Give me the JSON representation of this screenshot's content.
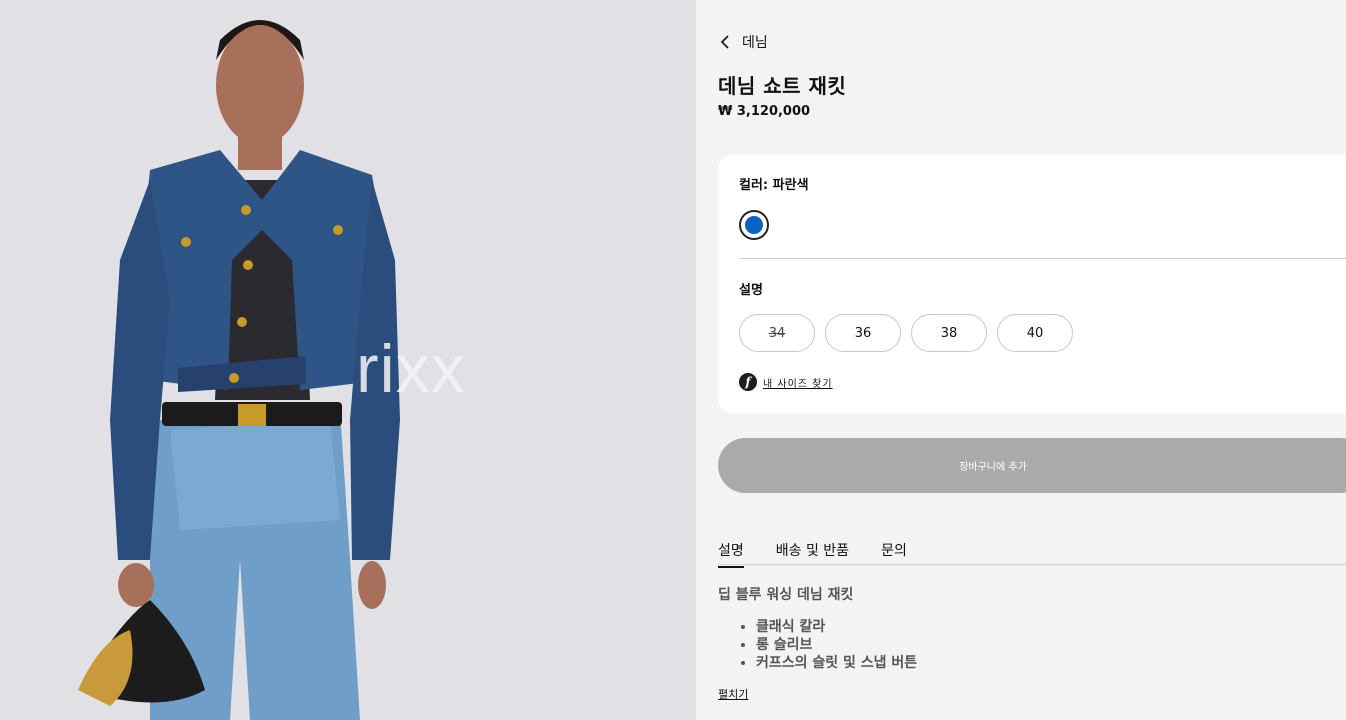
{
  "hero": {
    "watermark": "rixx"
  },
  "nav": {
    "back_label": "데님"
  },
  "product": {
    "title": "데님 쇼트 재킷",
    "price": "₩ 3,120,000"
  },
  "options": {
    "color_label": "컬러: 파란색",
    "color_swatch": "#0b62c4",
    "size_label": "설명",
    "sizes": [
      {
        "label": "34",
        "available": false
      },
      {
        "label": "36",
        "available": true
      },
      {
        "label": "38",
        "available": true
      },
      {
        "label": "40",
        "available": true
      }
    ],
    "size_finder_label": "내 사이즈 찾기"
  },
  "cart": {
    "add_label": "장바구니에 추가"
  },
  "tabs": [
    {
      "label": "설명",
      "active": true
    },
    {
      "label": "배송 및 반품",
      "active": false
    },
    {
      "label": "문의",
      "active": false
    }
  ],
  "description": {
    "title": "딥 블루 워싱 데님 재킷",
    "bullets": [
      "클래식 칼라",
      "롱 슬리브",
      "커프스의 슬릿 및 스냅 버튼"
    ],
    "expand_label": "펼치기"
  }
}
